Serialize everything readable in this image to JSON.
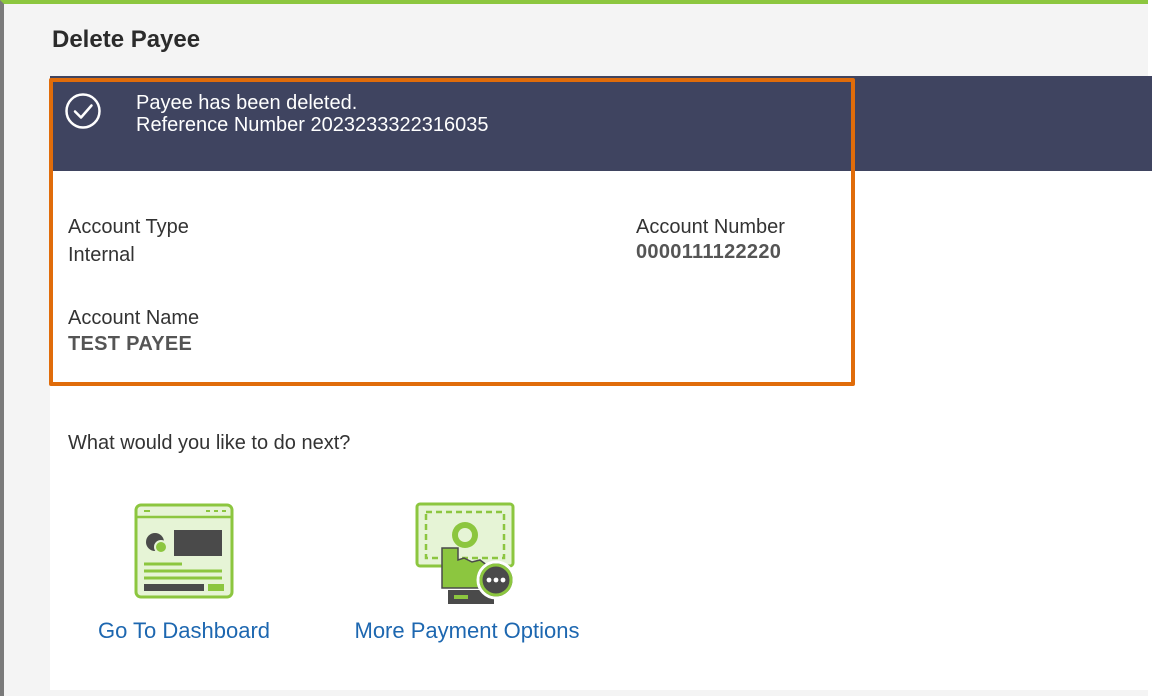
{
  "page": {
    "title": "Delete Payee"
  },
  "banner": {
    "message": "Payee has been deleted.",
    "reference": "Reference Number 2023233322316035",
    "icon": "check-circle-icon"
  },
  "details": {
    "account_type_label": "Account Type",
    "account_type_value": "Internal",
    "account_number_label": "Account Number",
    "account_number_value": "0000111122220",
    "account_name_label": "Account Name",
    "account_name_value": "TEST PAYEE"
  },
  "next_steps": {
    "prompt": "What would you like to do next?",
    "actions": [
      {
        "label": "Go To Dashboard",
        "icon": "dashboard-icon"
      },
      {
        "label": "More Payment Options",
        "icon": "payment-options-icon"
      }
    ]
  },
  "colors": {
    "banner_bg": "#3f4460",
    "highlight_border": "#e06c0a",
    "link": "#1d67b0",
    "icon_green": "#8cc63f",
    "top_border": "#8cc63f"
  }
}
